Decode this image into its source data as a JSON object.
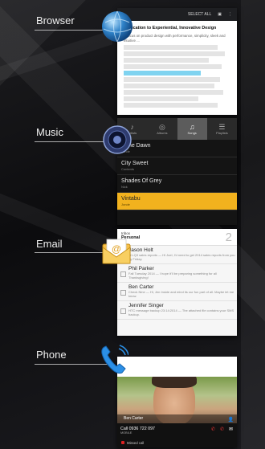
{
  "browser": {
    "label": "Browser",
    "toolbar": {
      "select_all": "SELECT ALL",
      "copy_icon": "copy-icon",
      "more_icon": "more-icon"
    },
    "page_title": "Dedication to Experiential, Innovative Design",
    "body_text": "A focus on product design with performance, simplicity, sleek and intuitive ..."
  },
  "music": {
    "label": "Music",
    "tabs": [
      {
        "label": "Artists",
        "icon": "mic-icon"
      },
      {
        "label": "Albums",
        "icon": "album-icon"
      },
      {
        "label": "Songs",
        "icon": "note-icon",
        "active": true
      },
      {
        "label": "Playlists",
        "icon": "list-icon"
      }
    ],
    "songs": [
      {
        "title": "Dune Dawn",
        "artist": "Jonde"
      },
      {
        "title": "City Sweet",
        "artist": "Contents"
      },
      {
        "title": "Shades Of Grey",
        "artist": "Nick"
      },
      {
        "title": "Vintabu",
        "artist": "Jonde",
        "highlight": true
      }
    ]
  },
  "email": {
    "label": "Email",
    "account": "Inbox",
    "folder": "Personal",
    "count": "2",
    "messages": [
      {
        "from": "Jason Holt",
        "snippet": "Q1-Q3 sales reports — Hi Joel, I'd need to get 2014 sales reports from you by Friday."
      },
      {
        "from": "Phil Parker",
        "snippet": "Fall Tuesday 2014 — I hope it'll be preparing something for all Thanksgiving!"
      },
      {
        "from": "Ben Carter",
        "snippet": "Check Nine — Hi, Jen Inside and mind its our fun part of all. Maybe let me know."
      },
      {
        "from": "Jennifer Singer",
        "snippet": "HTC message backup 23:14:2014 — The attached file contains your SMS backup."
      }
    ]
  },
  "phone": {
    "label": "Phone",
    "contact_name": "Ben Carter",
    "call_number": "Call 0936 722 097",
    "number_type": "MOBILE",
    "missed": "Missed call",
    "colors": {
      "accent": "#f2b21e",
      "missed": "#dd2222"
    }
  }
}
